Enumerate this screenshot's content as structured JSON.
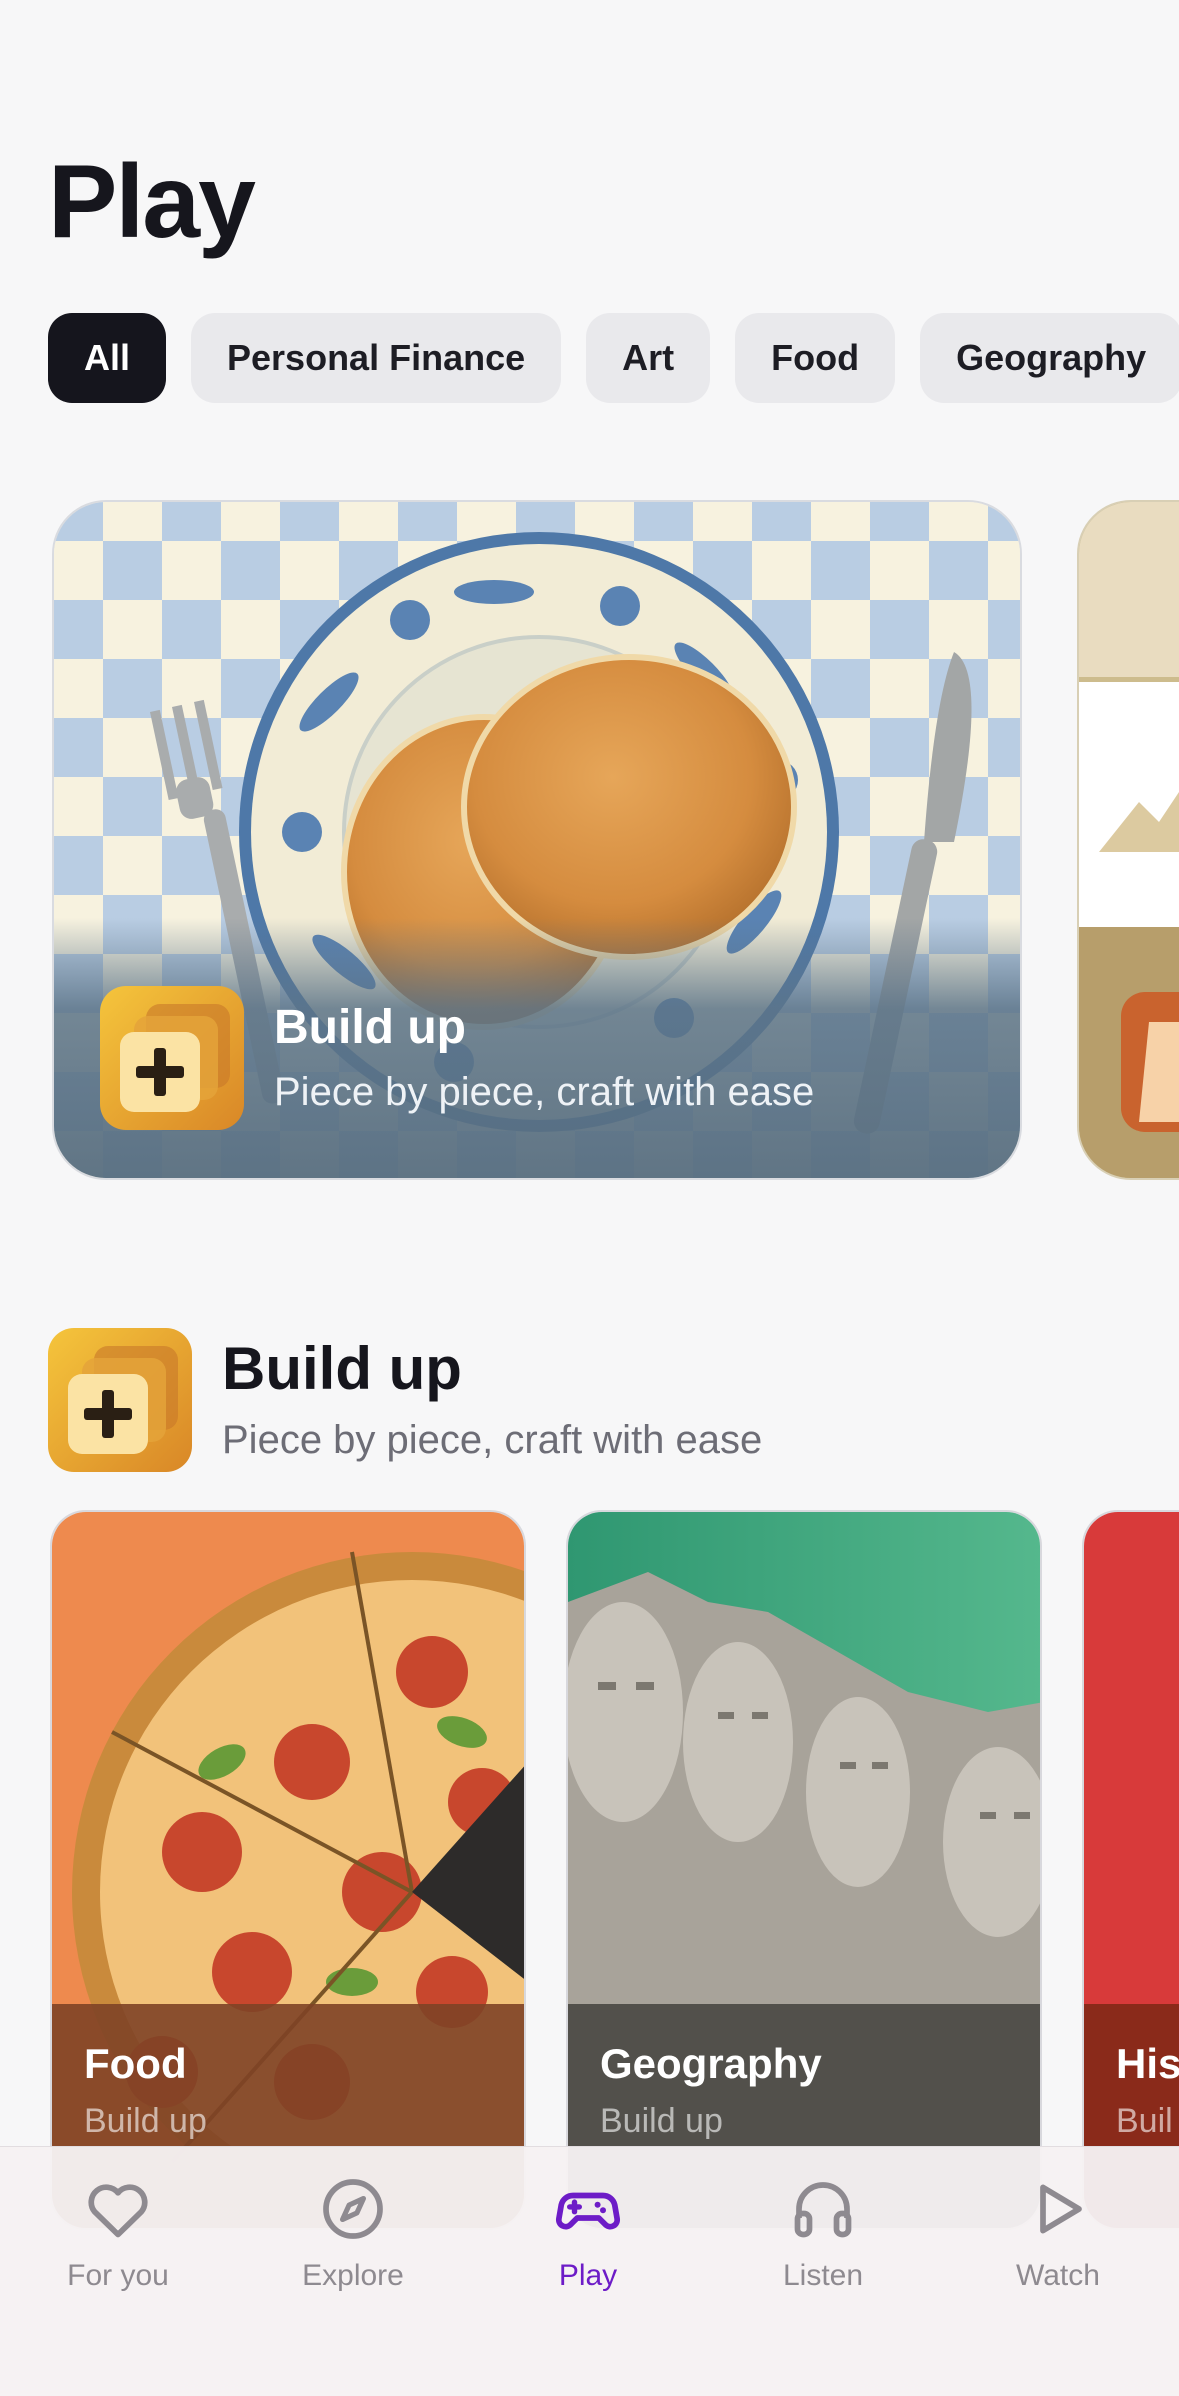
{
  "page": {
    "title": "Play"
  },
  "filters": {
    "items": [
      "All",
      "Personal Finance",
      "Art",
      "Food",
      "Geography"
    ],
    "selected": "All"
  },
  "hero": {
    "title": "Build up",
    "subtitle": "Piece by piece, craft with ease"
  },
  "section": {
    "title": "Build up",
    "subtitle": "Piece by piece, craft with ease"
  },
  "cards": [
    {
      "title": "Food",
      "subtitle": "Build up"
    },
    {
      "title": "Geography",
      "subtitle": "Build up"
    },
    {
      "title": "His",
      "subtitle": "Buil"
    }
  ],
  "tabs": [
    {
      "label": "For you",
      "icon": "heart-icon"
    },
    {
      "label": "Explore",
      "icon": "compass-icon"
    },
    {
      "label": "Play",
      "icon": "gamepad-icon"
    },
    {
      "label": "Listen",
      "icon": "headphones-icon"
    },
    {
      "label": "Watch",
      "icon": "play-icon"
    }
  ],
  "active_tab": "Play",
  "colors": {
    "accent": "#6d1cc7",
    "chip_active_bg": "#15151d",
    "chip_bg": "#e9e9ec",
    "food_card_bg": "#ee8a4e",
    "geography_card_bg": "#3fa57f",
    "history_card_bg": "#d83a3a"
  }
}
